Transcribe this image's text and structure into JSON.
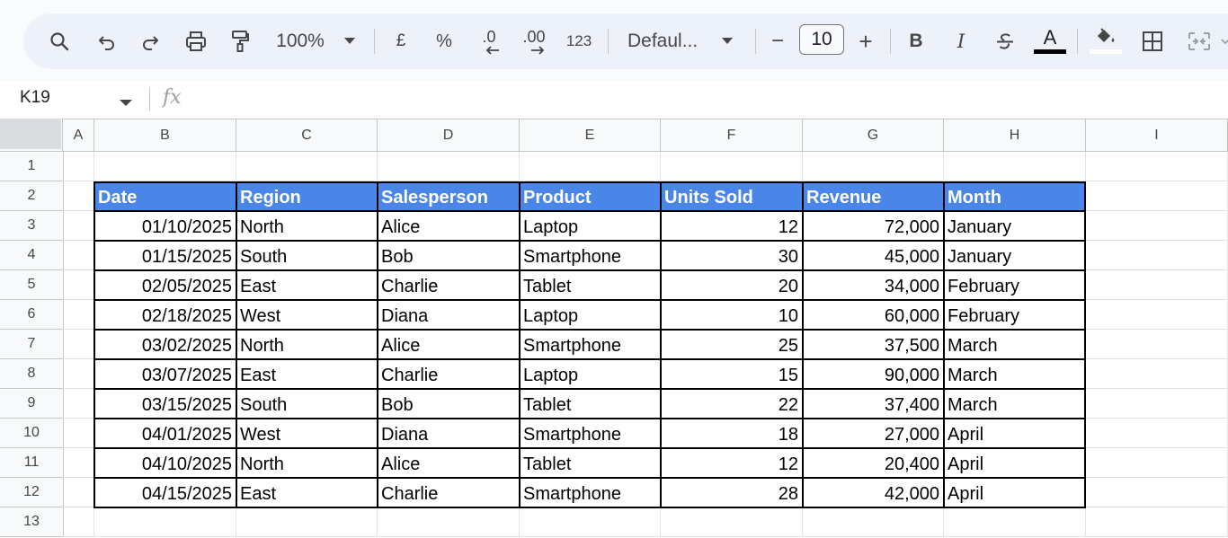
{
  "toolbar": {
    "zoom": "100%",
    "currency_symbol": "£",
    "percent_symbol": "%",
    "decrease_decimal": ".0",
    "increase_decimal": ".00",
    "number_format": "123",
    "font_name": "Defaul...",
    "font_size": "10",
    "minus": "−",
    "plus": "+",
    "bold": "B",
    "italic": "I",
    "text_color_letter": "A"
  },
  "formula_bar": {
    "cell_ref": "K19",
    "fx": "fx"
  },
  "colors": {
    "header_fill": "#4a86e8",
    "header_text": "#ffffff",
    "toolbar_bg": "#edf2fa"
  },
  "columns": [
    "A",
    "B",
    "C",
    "D",
    "E",
    "F",
    "G",
    "H",
    "I"
  ],
  "rows": [
    "1",
    "2",
    "3",
    "4",
    "5",
    "6",
    "7",
    "8",
    "9",
    "10",
    "11",
    "12",
    "13"
  ],
  "table": {
    "headers": [
      "Date",
      "Region",
      "Salesperson",
      "Product",
      "Units Sold",
      "Revenue",
      "Month"
    ],
    "rows": [
      [
        "01/10/2025",
        "North",
        "Alice",
        "Laptop",
        "12",
        "72,000",
        "January"
      ],
      [
        "01/15/2025",
        "South",
        "Bob",
        "Smartphone",
        "30",
        "45,000",
        "January"
      ],
      [
        "02/05/2025",
        "East",
        "Charlie",
        "Tablet",
        "20",
        "34,000",
        "February"
      ],
      [
        "02/18/2025",
        "West",
        "Diana",
        "Laptop",
        "10",
        "60,000",
        "February"
      ],
      [
        "03/02/2025",
        "North",
        "Alice",
        "Smartphone",
        "25",
        "37,500",
        "March"
      ],
      [
        "03/07/2025",
        "East",
        "Charlie",
        "Laptop",
        "15",
        "90,000",
        "March"
      ],
      [
        "03/15/2025",
        "South",
        "Bob",
        "Tablet",
        "22",
        "37,400",
        "March"
      ],
      [
        "04/01/2025",
        "West",
        "Diana",
        "Smartphone",
        "18",
        "27,000",
        "April"
      ],
      [
        "04/10/2025",
        "North",
        "Alice",
        "Tablet",
        "12",
        "20,400",
        "April"
      ],
      [
        "04/15/2025",
        "East",
        "Charlie",
        "Smartphone",
        "28",
        "42,000",
        "April"
      ]
    ]
  }
}
